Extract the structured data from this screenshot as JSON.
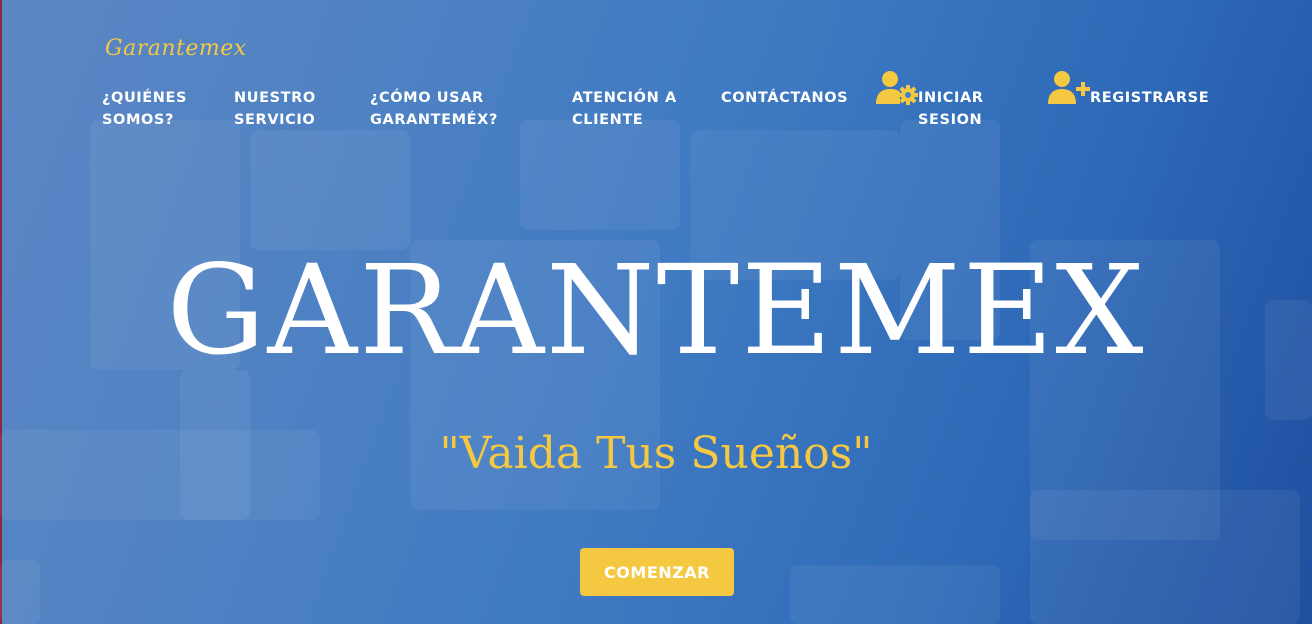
{
  "brand": {
    "name": "Garantemex"
  },
  "nav": {
    "quienes": [
      "¿QUIÉNES",
      "SOMOS?"
    ],
    "servicio": [
      "NUESTRO",
      "SERVICIO"
    ],
    "como_usar": [
      "¿CÓMO USAR",
      "GARANTEMÉX?"
    ],
    "atencion": [
      "ATENCIÓN A",
      "CLIENTE"
    ],
    "contactanos": "CONTÁCTANOS",
    "iniciar": [
      "INICIAR",
      "SESION"
    ],
    "registrarse": "REGISTRARSE"
  },
  "icons": {
    "login": "user-gear-icon",
    "register": "user-plus-icon"
  },
  "hero": {
    "title": "GARANTEMEX",
    "tagline": "\"Vaida Tus Sueños\"",
    "cta": "COMENZAR"
  },
  "colors": {
    "accent": "#f5c842",
    "text": "#ffffff",
    "background_start": "#5b86c4",
    "background_end": "#1f4fa0"
  }
}
